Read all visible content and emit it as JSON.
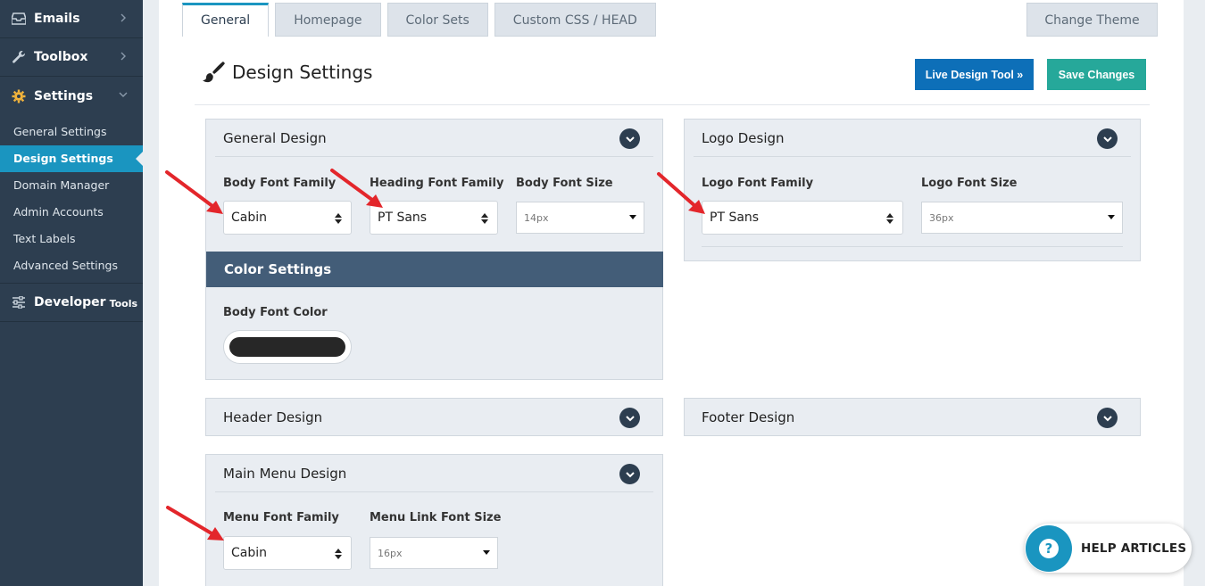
{
  "sidebar": {
    "main_items": [
      {
        "label": "Emails",
        "icon": "inbox-icon"
      },
      {
        "label": "Toolbox",
        "icon": "wrench-icon"
      },
      {
        "label": "Settings",
        "icon": "gear-icon"
      },
      {
        "label": "Developer",
        "suffix": "Tools",
        "icon": "sliders-icon"
      }
    ],
    "settings_sub": [
      "General Settings",
      "Design Settings",
      "Domain Manager",
      "Admin Accounts",
      "Text Labels",
      "Advanced Settings"
    ]
  },
  "tabs": [
    "General",
    "Homepage",
    "Color Sets",
    "Custom CSS / HEAD"
  ],
  "change_theme": "Change Theme",
  "page": {
    "title": "Design Settings",
    "live_button": "Live Design Tool »",
    "save_button": "Save Changes"
  },
  "general_design": {
    "title": "General Design",
    "body_font_family_label": "Body Font Family",
    "body_font_family": "Cabin",
    "heading_font_family_label": "Heading Font Family",
    "heading_font_family": "PT Sans",
    "body_font_size_label": "Body Font Size",
    "body_font_size": "14px"
  },
  "color_settings": {
    "title": "Color Settings",
    "body_font_color_label": "Body Font Color",
    "body_font_color": "#272727"
  },
  "logo_design": {
    "title": "Logo Design",
    "logo_font_family_label": "Logo Font Family",
    "logo_font_family": "PT Sans",
    "logo_font_size_label": "Logo Font Size",
    "logo_font_size": "36px"
  },
  "header_design": {
    "title": "Header Design"
  },
  "footer_design": {
    "title": "Footer Design"
  },
  "main_menu_design": {
    "title": "Main Menu Design",
    "menu_font_family_label": "Menu Font Family",
    "menu_font_family": "Cabin",
    "menu_link_font_size_label": "Menu Link Font Size",
    "menu_link_font_size": "16px"
  },
  "help": {
    "label": "HELP ARTICLES"
  },
  "colors": {
    "sidebar": "#2d3e50",
    "active": "#1a95c0",
    "live": "#0d6fb8",
    "save": "#26a89a",
    "annotation": "#e3262b"
  }
}
